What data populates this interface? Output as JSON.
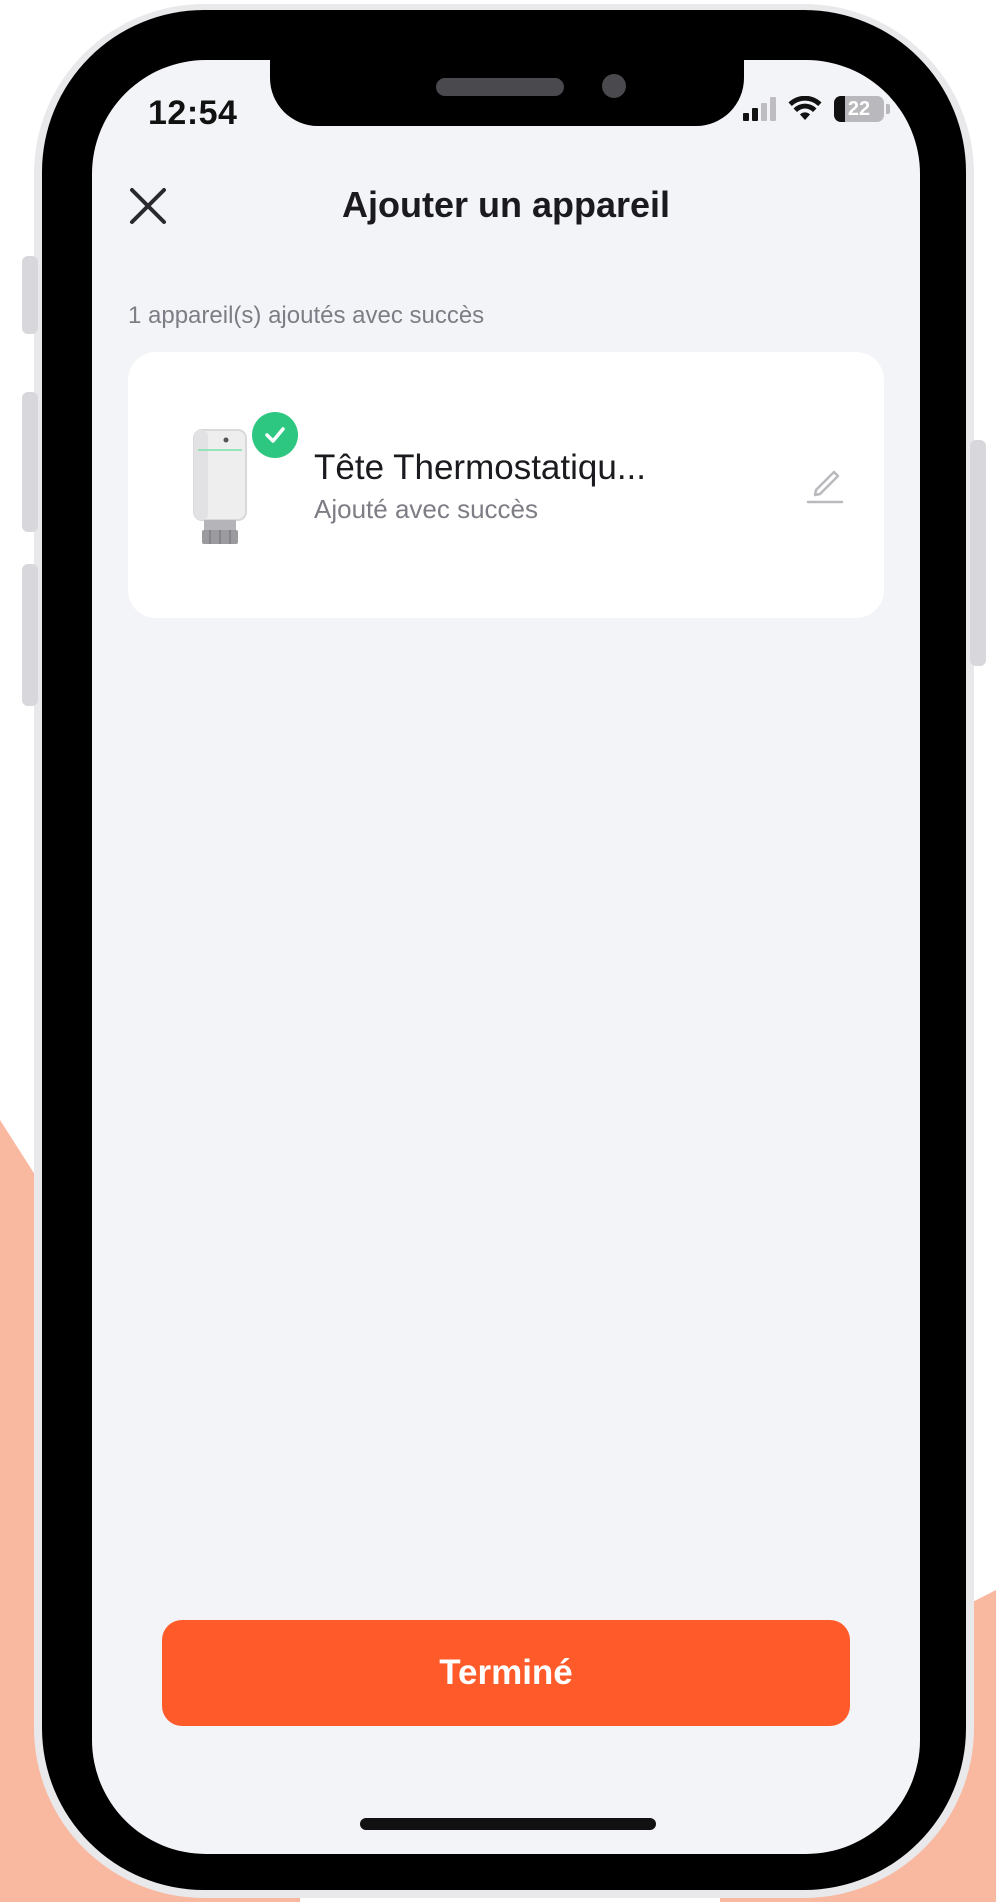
{
  "status_bar": {
    "time": "12:54",
    "battery": "22",
    "battery_level": 0.22,
    "signal_bars": 2,
    "wifi": true
  },
  "header": {
    "title": "Ajouter un appareil",
    "close_icon": "close-icon"
  },
  "section": {
    "label": "1 appareil(s) ajoutés avec succès"
  },
  "devices": [
    {
      "name": "Tête Thermostatiqu...",
      "status": "Ajouté avec succès",
      "badge_icon": "check-icon",
      "action_icon": "edit-icon"
    }
  ],
  "footer": {
    "done_label": "Terminé"
  },
  "colors": {
    "accent": "#ff5a29",
    "success": "#2ec781",
    "background": "#f3f4f8",
    "decoration": "#f9b8a0"
  }
}
